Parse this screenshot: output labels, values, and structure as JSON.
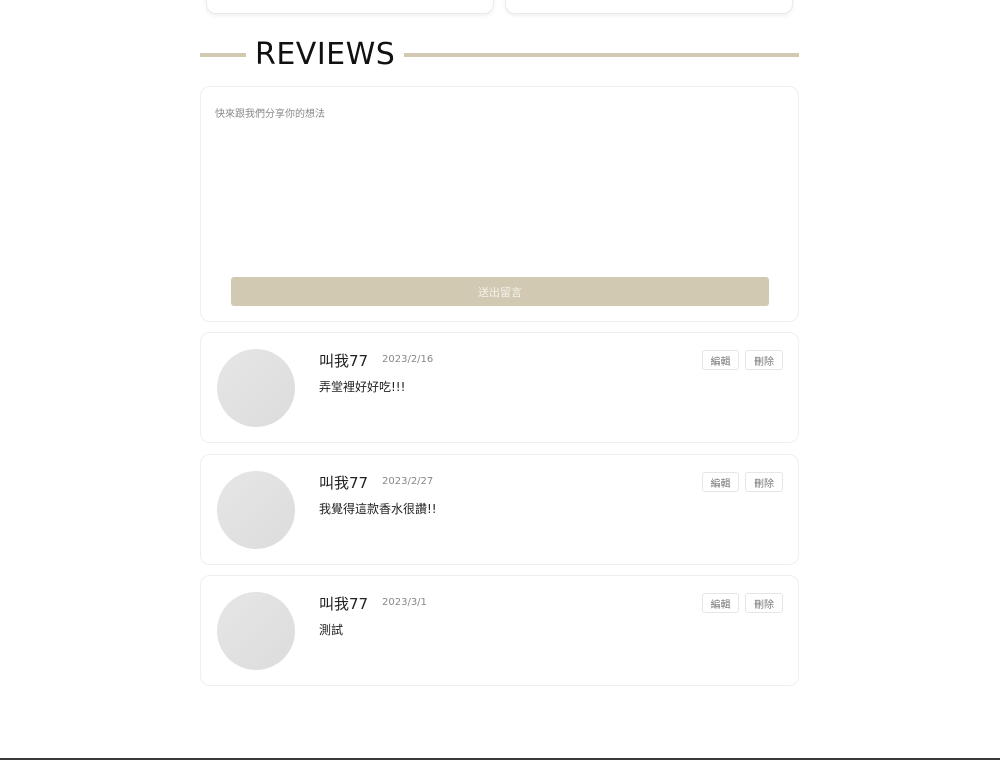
{
  "reviews_section": {
    "title": "REVIEWS",
    "compose": {
      "placeholder": "快來跟我們分享你的想法",
      "submit_label": "送出留言"
    },
    "items": [
      {
        "author": "叫我77",
        "date": "2023/2/16",
        "content": "弄堂裡好好吃!!!",
        "edit_label": "編輯",
        "delete_label": "刪除"
      },
      {
        "author": "叫我77",
        "date": "2023/2/27",
        "content": "我覺得這款香水很讚!!",
        "edit_label": "編輯",
        "delete_label": "刪除"
      },
      {
        "author": "叫我77",
        "date": "2023/3/1",
        "content": "測試",
        "edit_label": "編輯",
        "delete_label": "刪除"
      }
    ]
  },
  "colors": {
    "accent": "#d2c9b3",
    "border": "#efefef",
    "avatar": "#e3e3e3"
  }
}
